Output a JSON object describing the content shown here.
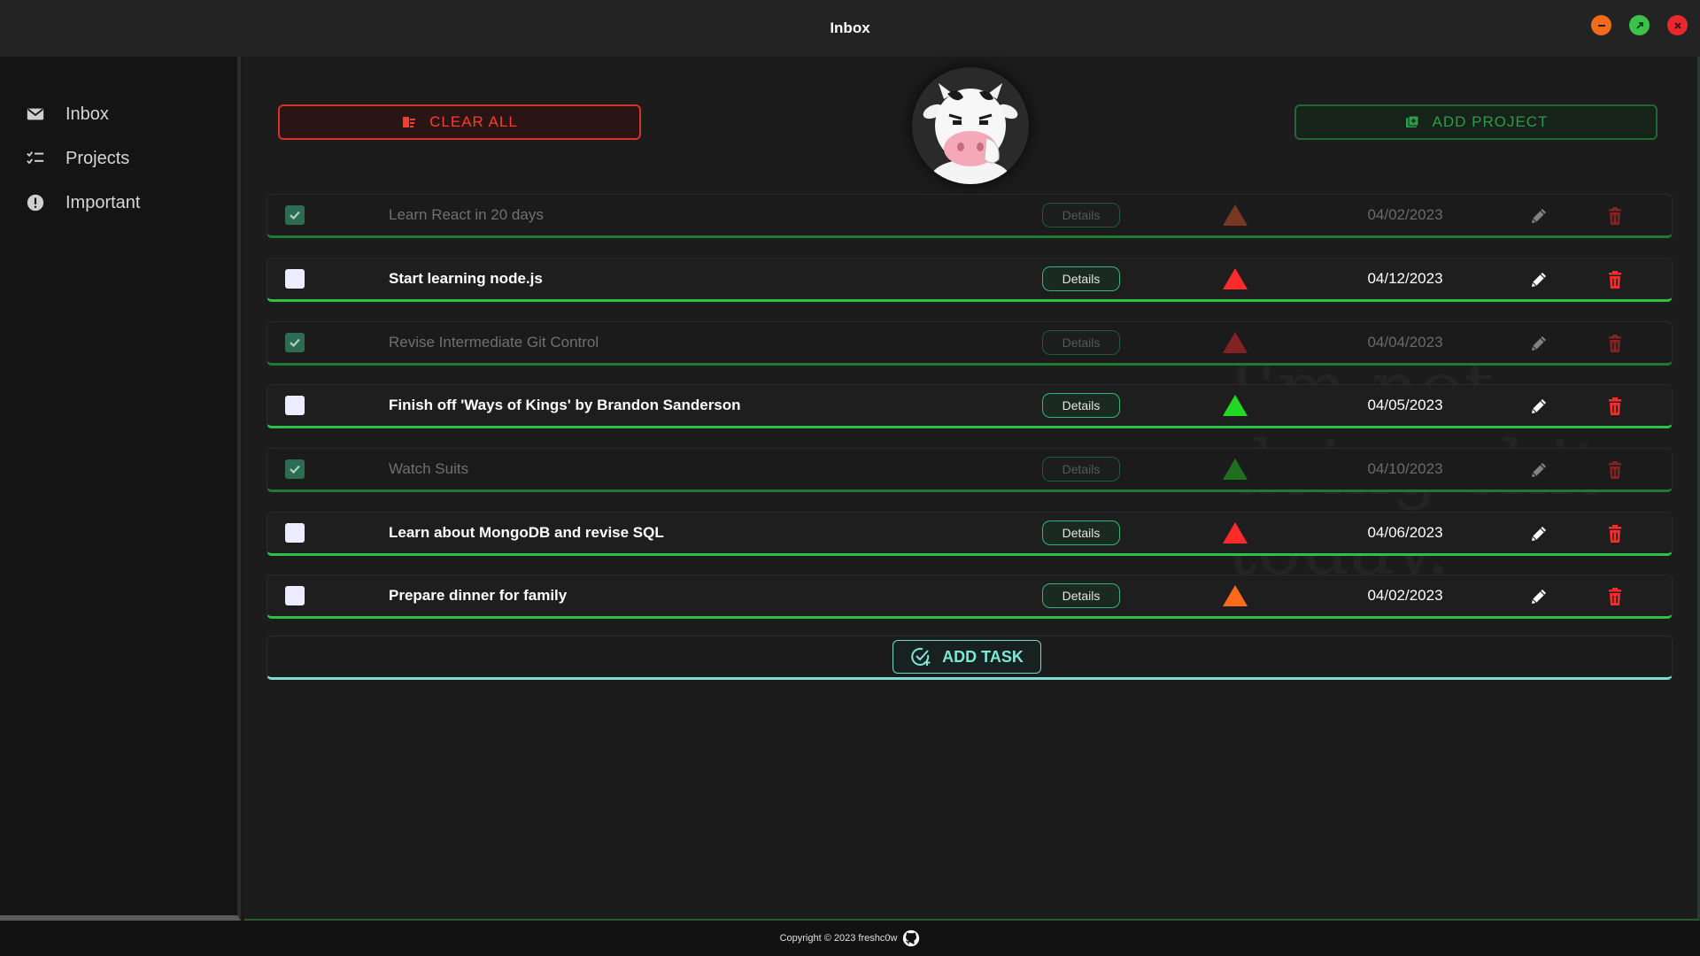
{
  "window": {
    "title": "Inbox",
    "controls": [
      "minimize-icon",
      "maximize-icon",
      "close-icon"
    ],
    "colors": {
      "minimize": "#f26b1d",
      "maximize": "#3cc24a",
      "close": "#e8282c"
    }
  },
  "sidebar": {
    "items": [
      {
        "label": "Inbox",
        "icon": "mail-icon"
      },
      {
        "label": "Projects",
        "icon": "checklist-icon"
      },
      {
        "label": "Important",
        "icon": "alert-icon"
      }
    ]
  },
  "toolbar": {
    "clear_label": "CLEAR ALL",
    "add_project_label": "ADD PROJECT"
  },
  "watermark": "I'm not\ndoing shit\ntoday.",
  "tasks": [
    {
      "title": "Learn React in 20 days",
      "done": true,
      "details": "Details",
      "priority": "medium",
      "priority_color": "#e85a2a",
      "date": "04/02/2023"
    },
    {
      "title": "Start learning node.js",
      "done": false,
      "details": "Details",
      "priority": "high",
      "priority_color": "#ff2b2b",
      "date": "04/12/2023"
    },
    {
      "title": "Revise Intermediate Git Control",
      "done": true,
      "details": "Details",
      "priority": "high",
      "priority_color": "#ff2b2b",
      "date": "04/04/2023"
    },
    {
      "title": "Finish off 'Ways of Kings' by Brandon Sanderson",
      "done": false,
      "details": "Details",
      "priority": "low",
      "priority_color": "#22d822",
      "date": "04/05/2023"
    },
    {
      "title": "Watch Suits",
      "done": true,
      "details": "Details",
      "priority": "low",
      "priority_color": "#22d822",
      "date": "04/10/2023"
    },
    {
      "title": "Learn about MongoDB and revise SQL",
      "done": false,
      "details": "Details",
      "priority": "high",
      "priority_color": "#ff2b2b",
      "date": "04/06/2023"
    },
    {
      "title": "Prepare dinner for family",
      "done": false,
      "details": "Details",
      "priority": "medium",
      "priority_color": "#ff6a1a",
      "date": "04/02/2023"
    }
  ],
  "add_task_label": "ADD TASK",
  "footer": {
    "text": "Copyright © 2023 freshc0w",
    "icon": "github-icon"
  }
}
